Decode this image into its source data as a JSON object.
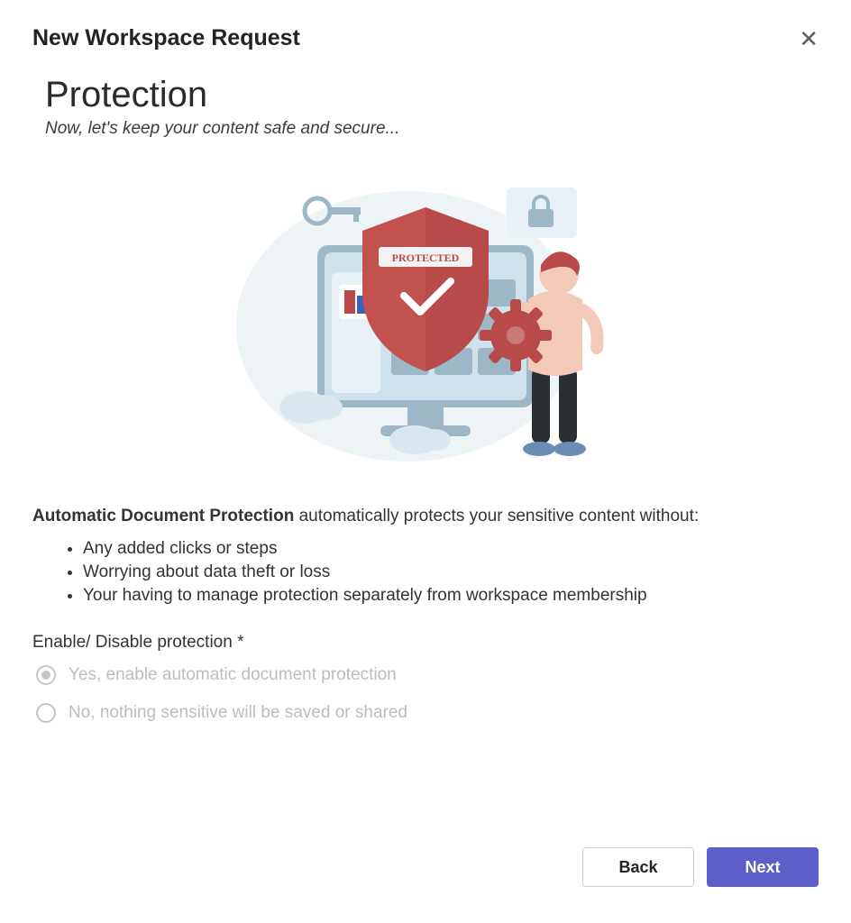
{
  "dialog": {
    "title": "New Workspace Request"
  },
  "section": {
    "title": "Protection",
    "subtitle": "Now, let's keep your content safe and secure..."
  },
  "illustration": {
    "badge_text": "PROTECTED"
  },
  "description": {
    "lead_bold": "Automatic Document Protection",
    "lead_rest": " automatically protects your sensitive content without:",
    "benefits": [
      "Any added clicks or steps",
      "Worrying about data theft or loss",
      "Your having to manage protection separately from workspace membership"
    ]
  },
  "form": {
    "field_label": "Enable/ Disable protection *",
    "options": [
      {
        "label": "Yes, enable automatic document protection",
        "selected": true
      },
      {
        "label": "No, nothing sensitive will be saved or shared",
        "selected": false
      }
    ]
  },
  "footer": {
    "back": "Back",
    "next": "Next"
  }
}
